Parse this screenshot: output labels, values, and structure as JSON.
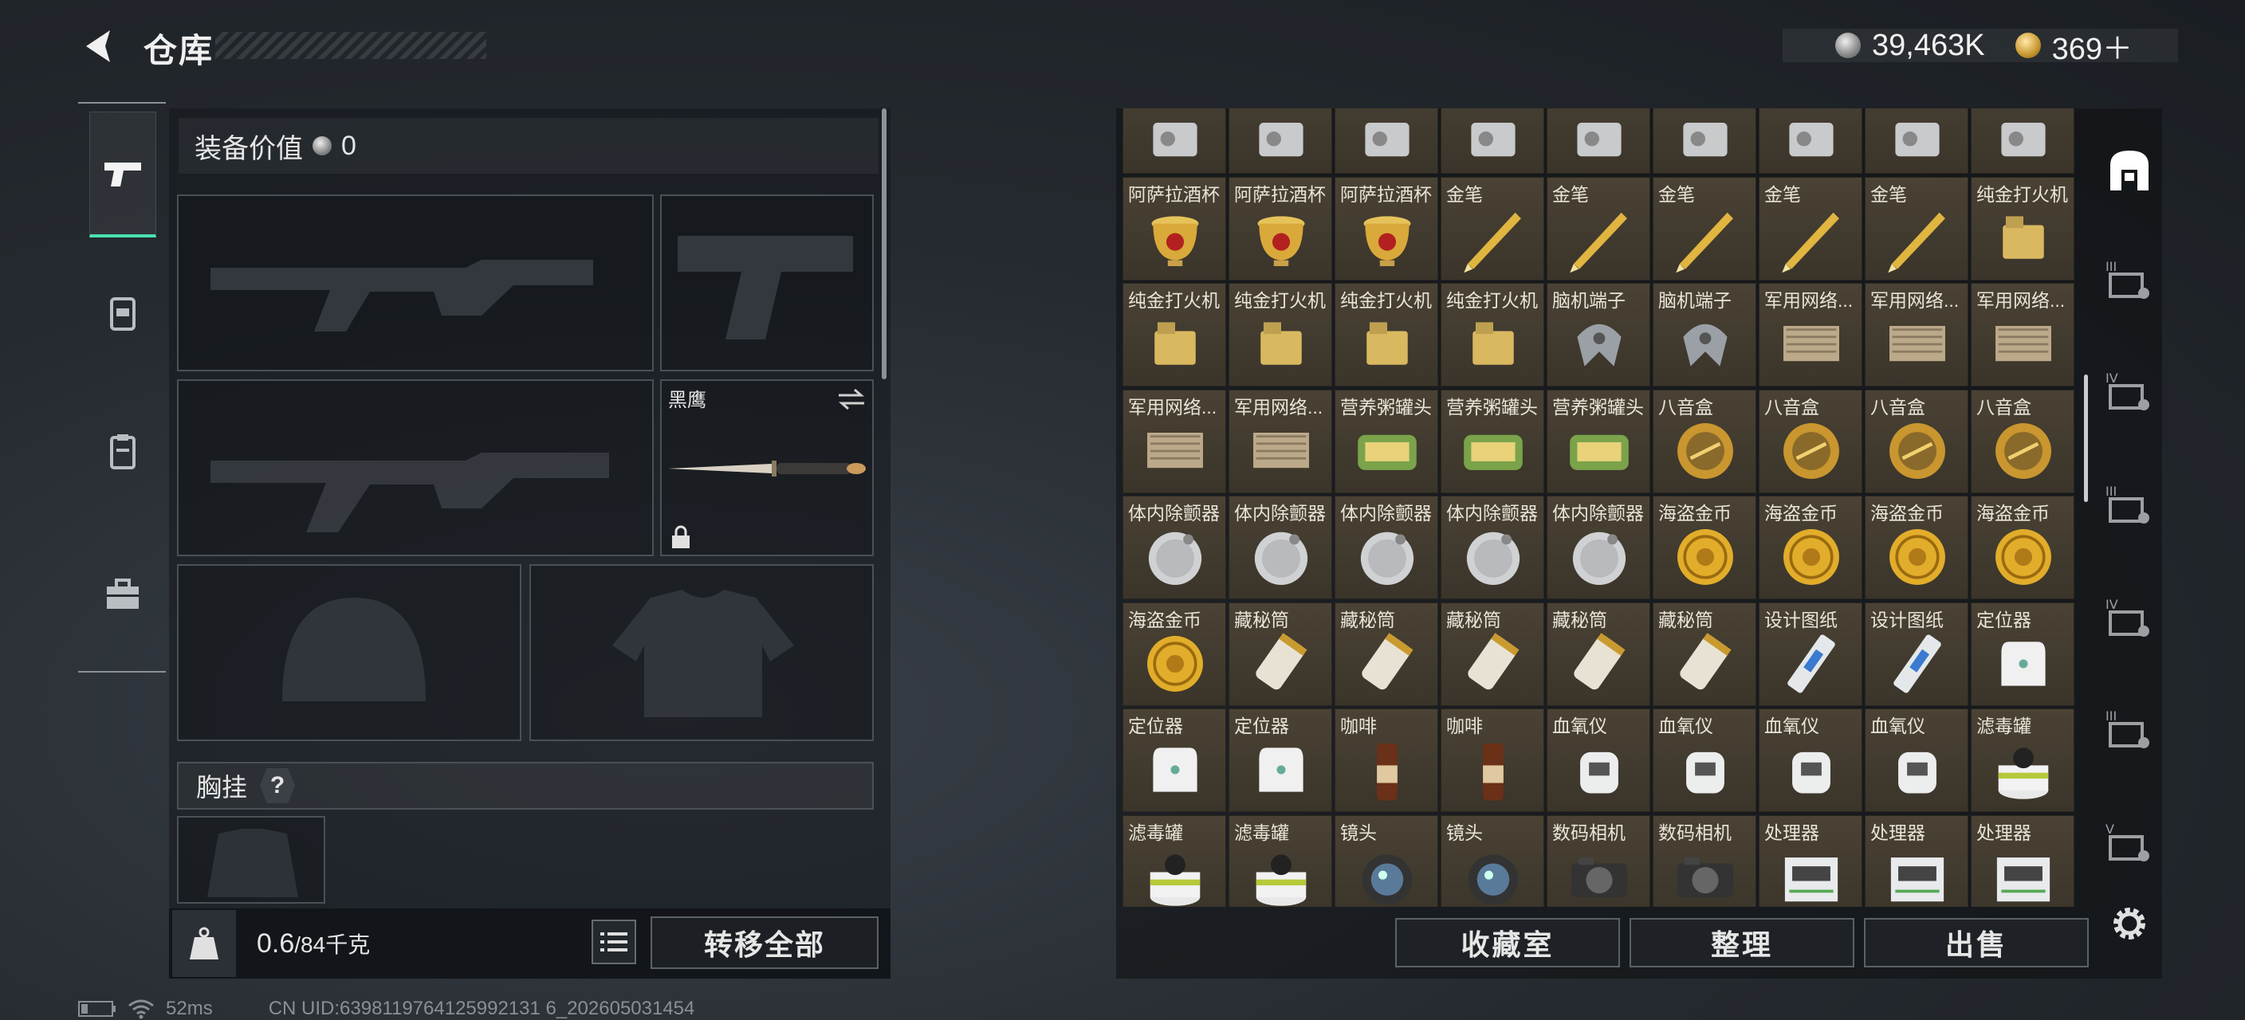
{
  "header": {
    "title": "仓库"
  },
  "currency": [
    {
      "icon": "silver-coin-icon",
      "value": "39,463K"
    },
    {
      "icon": "gold-coin-icon",
      "value": "369＋"
    }
  ],
  "equipment": {
    "value_label": "装备价值",
    "value": "0",
    "melee_name": "黑鹰",
    "chest_label": "胸挂",
    "help": "?",
    "weight_current": "0.6",
    "weight_max": "/84千克",
    "transfer_all": "转移全部"
  },
  "stash": {
    "items": [
      "",
      "",
      "",
      "",
      "",
      "",
      "",
      "",
      "",
      "阿萨拉酒杯",
      "阿萨拉酒杯",
      "阿萨拉酒杯",
      "金笔",
      "金笔",
      "金笔",
      "金笔",
      "金笔",
      "纯金打火机",
      "纯金打火机",
      "纯金打火机",
      "纯金打火机",
      "纯金打火机",
      "脑机端子",
      "脑机端子",
      "军用网络...",
      "军用网络...",
      "军用网络...",
      "军用网络...",
      "军用网络...",
      "营养粥罐头",
      "营养粥罐头",
      "营养粥罐头",
      "八音盒",
      "八音盒",
      "八音盒",
      "八音盒",
      "体内除颤器",
      "体内除颤器",
      "体内除颤器",
      "体内除颤器",
      "体内除颤器",
      "海盗金币",
      "海盗金币",
      "海盗金币",
      "海盗金币",
      "海盗金币",
      "藏秘筒",
      "藏秘筒",
      "藏秘筒",
      "藏秘筒",
      "藏秘筒",
      "设计图纸",
      "设计图纸",
      "定位器",
      "定位器",
      "定位器",
      "咖啡",
      "咖啡",
      "血氧仪",
      "血氧仪",
      "血氧仪",
      "血氧仪",
      "滤毒罐",
      "滤毒罐",
      "滤毒罐",
      "镜头",
      "镜头",
      "数码相机",
      "数码相机",
      "处理器",
      "处理器",
      "处理器"
    ],
    "buttons": {
      "collection": "收藏室",
      "sort": "整理",
      "sell": "出售"
    }
  },
  "status": {
    "ping": "52ms",
    "uid": "CN UID:6398119764125992131 6_202605031454"
  }
}
